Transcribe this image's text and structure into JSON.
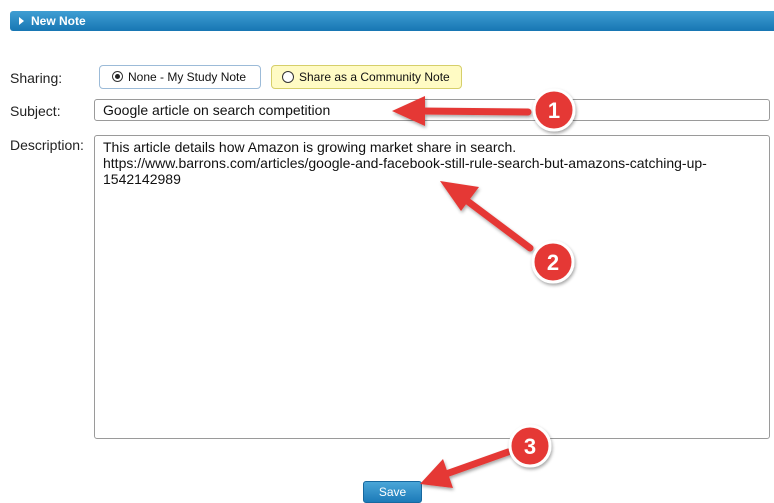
{
  "header": {
    "title": "New Note"
  },
  "form": {
    "sharing_label": "Sharing:",
    "sharing_options": [
      {
        "label": "None - My Study Note",
        "selected": true
      },
      {
        "label": "Share as a Community Note",
        "selected": false
      }
    ],
    "subject_label": "Subject:",
    "subject_value": "Google article on search competition",
    "description_label": "Description:",
    "description_value": "This article details how Amazon is growing market share in search.\nhttps://www.barrons.com/articles/google-and-facebook-still-rule-search-but-amazons-catching-up-1542142989",
    "save_label": "Save"
  },
  "annotations": {
    "badges": [
      "1",
      "2",
      "3"
    ],
    "arrow_color": "#e53935"
  }
}
